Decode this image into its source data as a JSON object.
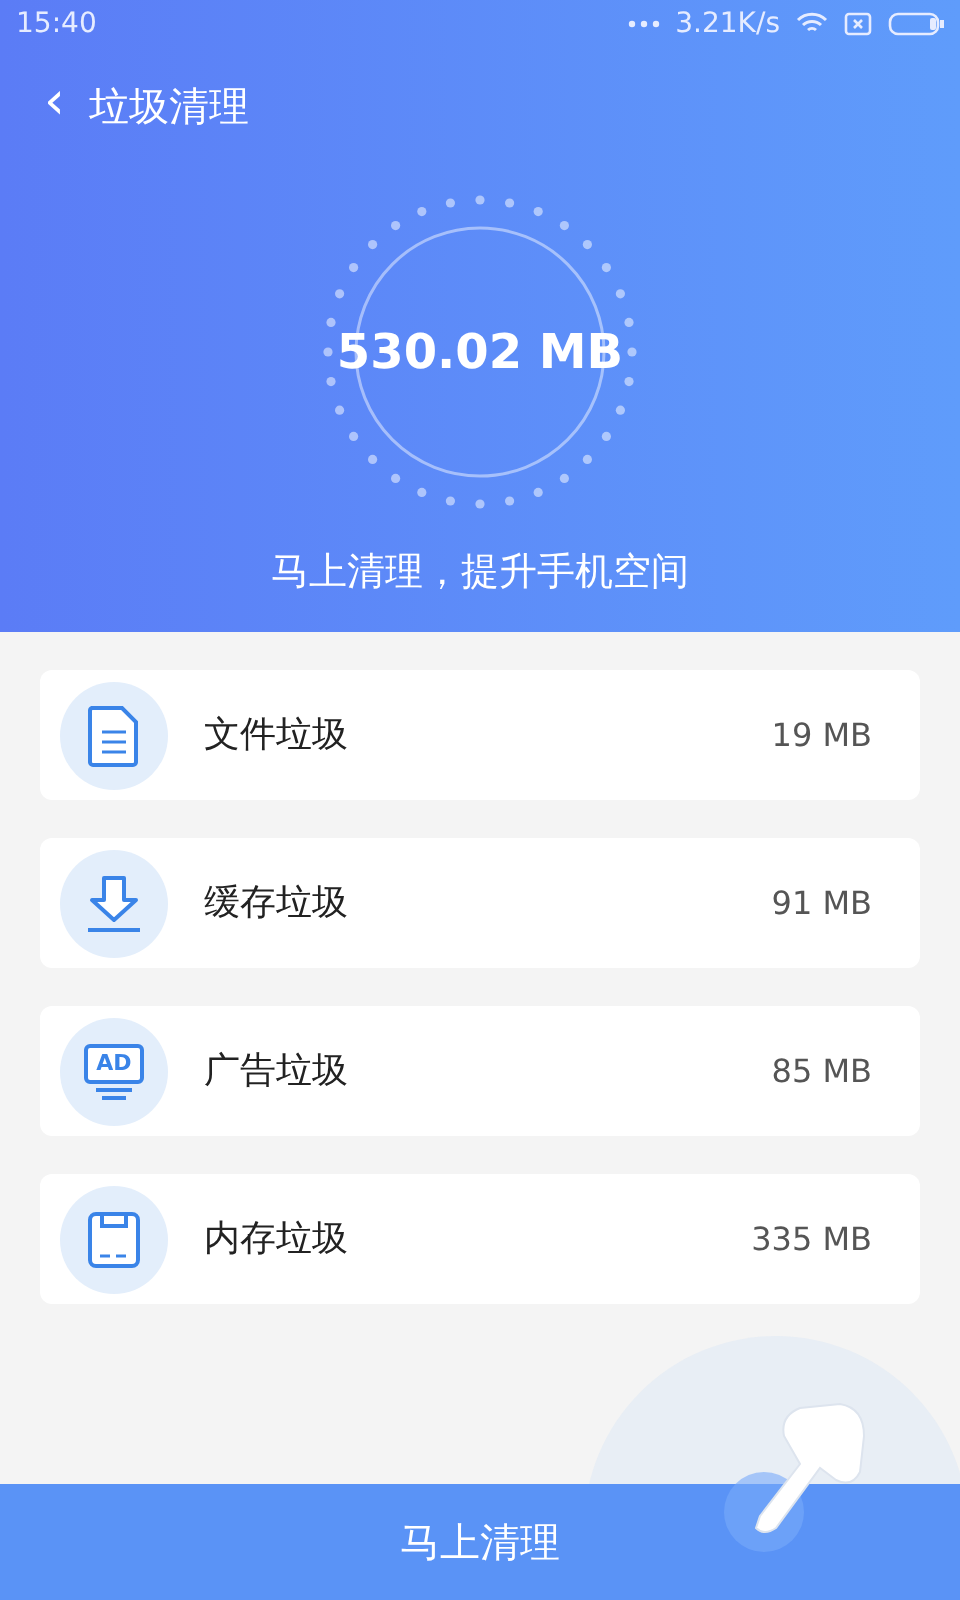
{
  "status_bar": {
    "time": "15:40",
    "speed": "3.21K/s"
  },
  "header": {
    "back": "‹",
    "title": "垃圾清理"
  },
  "meter": {
    "total": "530.02 MB",
    "caption": "马上清理，提升手机空间"
  },
  "items": [
    {
      "kind": "file",
      "label": "文件垃圾",
      "size": "19 MB"
    },
    {
      "kind": "download",
      "label": "缓存垃圾",
      "size": "91 MB"
    },
    {
      "kind": "ad",
      "icon_text": "AD",
      "label": "广告垃圾",
      "size": "85 MB"
    },
    {
      "kind": "storage",
      "label": "内存垃圾",
      "size": "335 MB"
    }
  ],
  "action": {
    "label": "马上清理"
  }
}
